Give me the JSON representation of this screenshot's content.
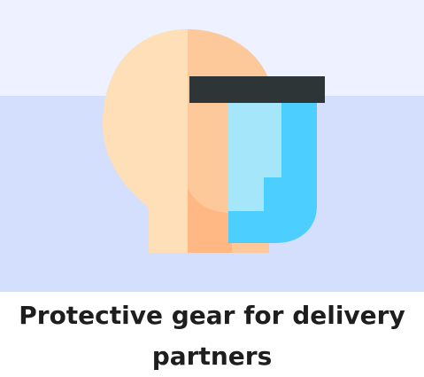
{
  "card": {
    "title": "Protective gear for delivery partners",
    "icon": "face-shield-icon"
  },
  "colors": {
    "background_top": "#eef1ff",
    "background_bottom": "#d4defd",
    "skin_light": "#ffdfb8",
    "skin_mid": "#fdc99b",
    "skin_dark": "#ffb884",
    "shield_band": "#2e3537",
    "shield_blue": "#4ccfff",
    "shield_light": "#a6e6fa",
    "title_text": "#1e1e1e"
  }
}
